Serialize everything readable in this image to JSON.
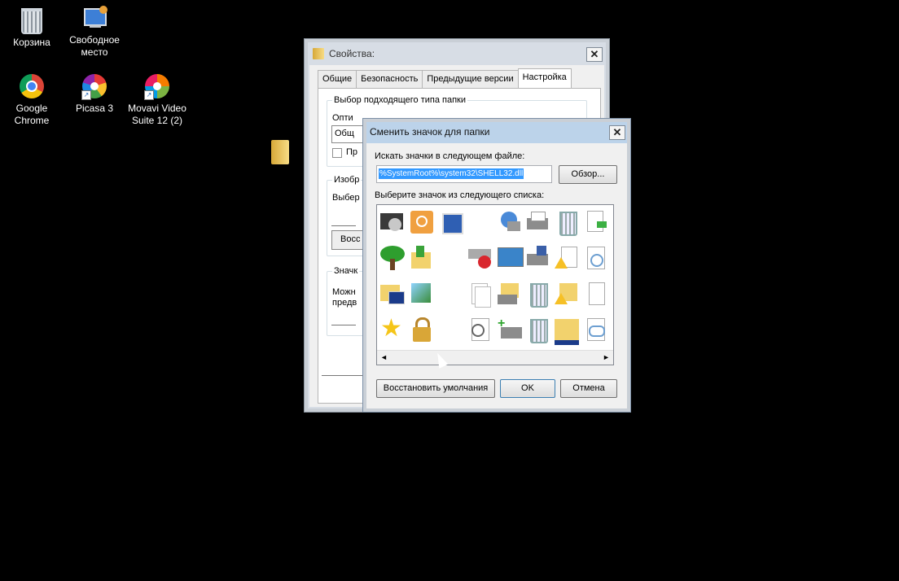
{
  "desktop": {
    "icons": [
      {
        "label": "Корзина",
        "icon": "recycle-bin-icon"
      },
      {
        "label": "Свободное место",
        "icon": "computer-icon"
      },
      {
        "label": "Google Chrome",
        "icon": "chrome-icon"
      },
      {
        "label": "Picasa 3",
        "icon": "picasa-icon"
      },
      {
        "label": "Movavi Video Suite 12 (2)",
        "icon": "movavi-icon"
      }
    ]
  },
  "properties": {
    "title": "Свойства:",
    "tabs": [
      "Общие",
      "Безопасность",
      "Предыдущие версии",
      "Настройка"
    ],
    "active_tab": "Настройка",
    "group1_title": "Выбор подходящего типа папки",
    "frag_opt": "Опти",
    "frag_gen": "Общ",
    "frag_pr": "Пр",
    "group2_title": "Изобр",
    "frag_vyb": "Выбер",
    "frag_vos": "Восс",
    "group3_title": "Значк",
    "frag_mozh": "Можн",
    "frag_pred": "предв"
  },
  "change_icon": {
    "title": "Сменить значок для папки",
    "search_label": "Искать значки в следующем файле:",
    "path_value": "%SystemRoot%\\system32\\SHELL32.dll",
    "browse_label": "Обзор...",
    "list_label": "Выберите значок из следующего списка:",
    "restore_label": "Восстановить умолчания",
    "ok_label": "OK",
    "cancel_label": "Отмена",
    "scroll_left": "◄",
    "scroll_right": "►"
  },
  "colors": {
    "selection": "#3399ff",
    "dialog_frame": "#bcd3ea",
    "desktop": "#000000"
  }
}
